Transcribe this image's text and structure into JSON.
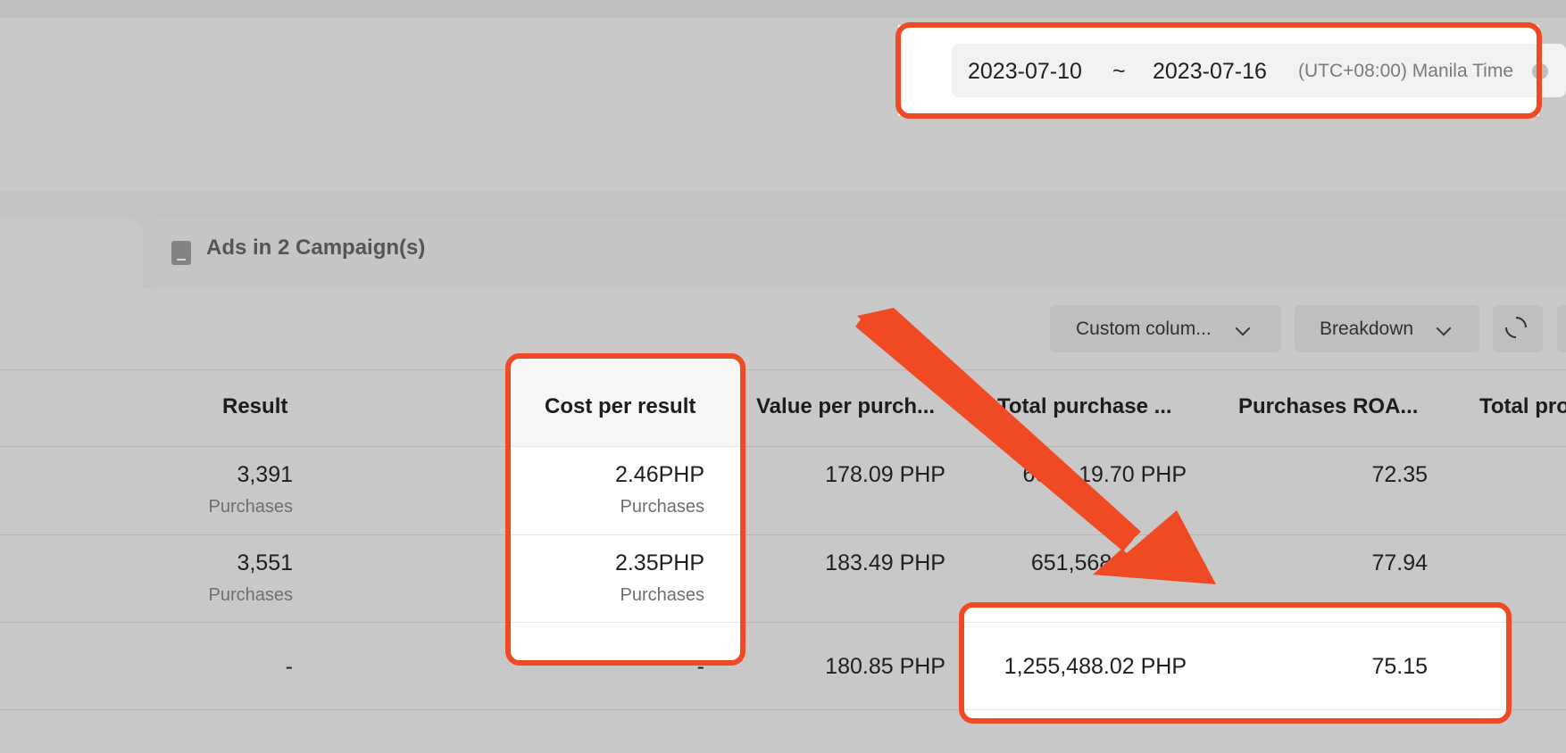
{
  "date_range": {
    "start": "2023-07-10",
    "separator": "~",
    "end": "2023-07-16",
    "timezone": "(UTC+08:00) Manila Time"
  },
  "tabs": {
    "active_label": "Ads in 2 Campaign(s)"
  },
  "toolbar": {
    "custom_columns_label": "Custom colum...",
    "breakdown_label": "Breakdown"
  },
  "table": {
    "headers": {
      "result": "Result",
      "cost_per_result": "Cost per result",
      "value_per_purchase": "Value per purch...",
      "total_purchase": "Total purchase ...",
      "purchases_roas": "Purchases ROA...",
      "total_pro": "Total pro"
    },
    "rows": [
      {
        "result": "3,391",
        "result_sub": "Purchases",
        "cost": "2.46PHP",
        "cost_sub": "Purchases",
        "value": "178.09 PHP",
        "total": "60     19.70 PHP",
        "roas": "72.35"
      },
      {
        "result": "3,551",
        "result_sub": "Purchases",
        "cost": "2.35PHP",
        "cost_sub": "Purchases",
        "value": "183.49 PHP",
        "total": "651,568.32",
        "roas": "77.94"
      }
    ],
    "total_row": {
      "result": "-",
      "cost": "-",
      "value": "180.85 PHP",
      "total": "1,255,488.02 PHP",
      "roas": "75.15"
    }
  },
  "annotation_color": "#f04a24"
}
